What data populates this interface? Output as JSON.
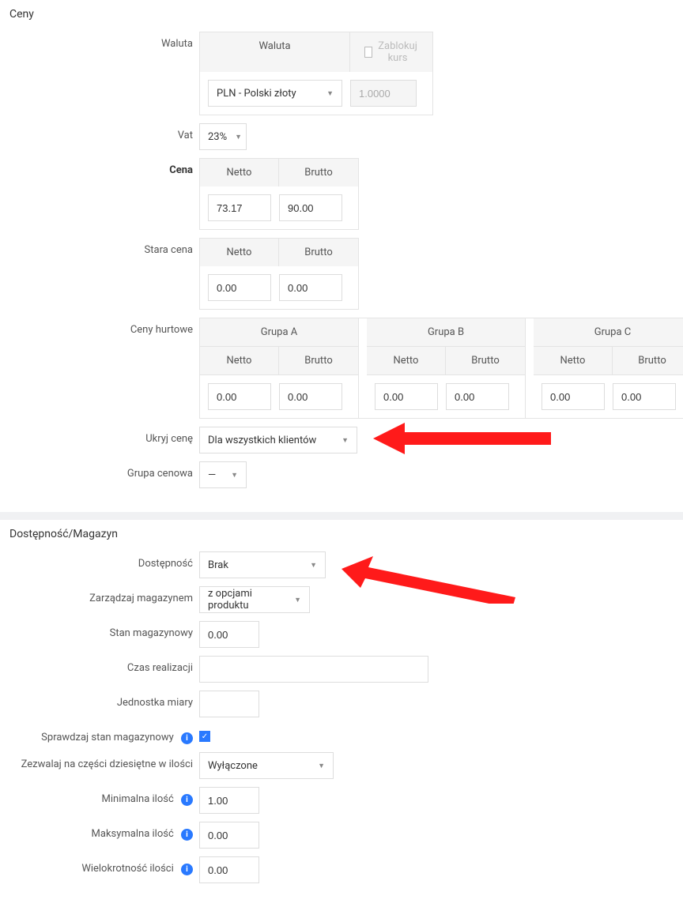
{
  "prices": {
    "section_title": "Ceny",
    "currency_label": "Waluta",
    "currency_header": "Waluta",
    "lock_rate_label": "Zablokuj kurs",
    "currency_value": "PLN - Polski złoty",
    "rate_value": "1.0000",
    "vat_label": "Vat",
    "vat_value": "23%",
    "price_label": "Cena",
    "netto_header": "Netto",
    "brutto_header": "Brutto",
    "price_netto": "73.17",
    "price_brutto": "90.00",
    "old_price_label": "Stara cena",
    "old_price_netto": "0.00",
    "old_price_brutto": "0.00",
    "wholesale_label": "Ceny hurtowe",
    "groups": [
      {
        "name": "Grupa A",
        "netto": "0.00",
        "brutto": "0.00"
      },
      {
        "name": "Grupa B",
        "netto": "0.00",
        "brutto": "0.00"
      },
      {
        "name": "Grupa C",
        "netto": "0.00",
        "brutto": "0.00"
      }
    ],
    "hide_price_label": "Ukryj cenę",
    "hide_price_value": "Dla wszystkich klientów",
    "price_group_label": "Grupa cenowa",
    "price_group_value": "—"
  },
  "stock": {
    "section_title": "Dostępność/Magazyn",
    "availability_label": "Dostępność",
    "availability_value": "Brak",
    "manage_label": "Zarządzaj magazynem",
    "manage_value": "z opcjami produktu",
    "stock_level_label": "Stan magazynowy",
    "stock_level_value": "0.00",
    "lead_time_label": "Czas realizacji",
    "lead_time_value": "",
    "unit_label": "Jednostka miary",
    "unit_value": "",
    "check_stock_label": "Sprawdzaj stan magazynowy",
    "decimal_label": "Zezwalaj na części dziesiętne w ilości",
    "decimal_value": "Wyłączone",
    "min_qty_label": "Minimalna ilość",
    "min_qty_value": "1.00",
    "max_qty_label": "Maksymalna ilość",
    "max_qty_value": "0.00",
    "multiplicity_label": "Wielokrotność ilości",
    "multiplicity_value": "0.00"
  }
}
